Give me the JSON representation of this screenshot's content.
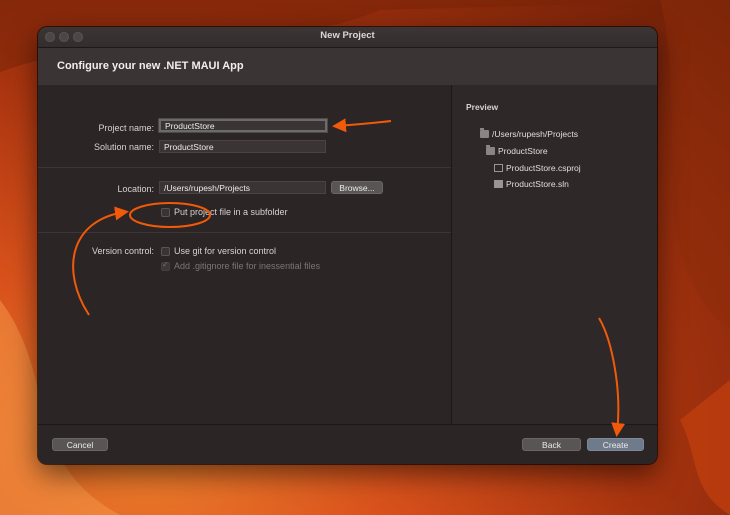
{
  "window": {
    "title": "New Project"
  },
  "header": {
    "title": "Configure your new .NET MAUI App"
  },
  "form": {
    "project_name_label": "Project name:",
    "project_name_value": "ProductStore",
    "solution_name_label": "Solution name:",
    "solution_name_value": "ProductStore",
    "location_label": "Location:",
    "location_value": "/Users/rupesh/Projects",
    "browse_label": "Browse...",
    "subfolder_label": "Put project file in a subfolder",
    "subfolder_checked": false,
    "version_control_label": "Version control:",
    "use_git_label": "Use git for version control",
    "use_git_checked": false,
    "gitignore_label": "Add .gitignore file for inessential files",
    "gitignore_checked": true,
    "gitignore_disabled": true
  },
  "preview": {
    "title": "Preview",
    "tree": [
      {
        "label": "/Users/rupesh/Projects",
        "icon": "folder-icon"
      },
      {
        "label": "ProductStore",
        "icon": "folder-icon"
      },
      {
        "label": "ProductStore.csproj",
        "icon": "file-icon"
      },
      {
        "label": "ProductStore.sln",
        "icon": "solution-icon"
      }
    ]
  },
  "footer": {
    "cancel_label": "Cancel",
    "back_label": "Back",
    "create_label": "Create"
  },
  "colors": {
    "annotation": "#f25a0a",
    "window_bg": "#2a2424",
    "primary_button": "#6f7a8a"
  }
}
